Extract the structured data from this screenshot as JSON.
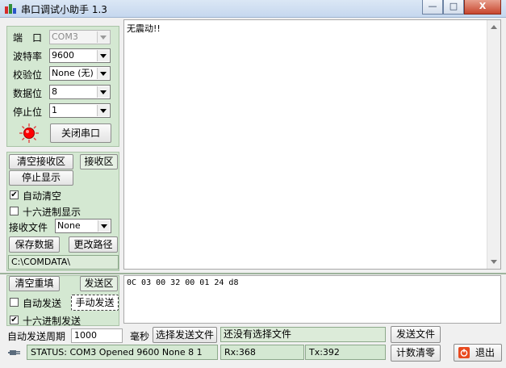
{
  "window": {
    "title": "串口调试小助手 1.3",
    "controls": {
      "min": "—",
      "max": "□",
      "close": "X"
    }
  },
  "settings": {
    "port_label": "端　口",
    "port_value": "COM3",
    "baud_label": "波特率",
    "baud_value": "9600",
    "parity_label": "校验位",
    "parity_value": "None (无)",
    "databits_label": "数据位",
    "databits_value": "8",
    "stopbits_label": "停止位",
    "stopbits_value": "1",
    "close_port_button": "关闭串口",
    "led_color": "#ff0000"
  },
  "receive": {
    "clear_button": "清空接收区",
    "area_label": "接收区",
    "stop_display_button": "停止显示",
    "auto_clear_label": "自动清空",
    "auto_clear_checked": true,
    "hex_display_label": "十六进制显示",
    "hex_display_checked": false,
    "file_label": "接收文件",
    "file_value": "None",
    "save_data_button": "保存数据",
    "change_path_button": "更改路径",
    "path_value": "C:\\COMDATA\\",
    "content": "无震动!!"
  },
  "send": {
    "clear_resend_button": "清空重填",
    "area_label": "发送区",
    "auto_send_label": "自动发送",
    "auto_send_checked": false,
    "manual_send_button": "手动发送",
    "hex_send_label": "十六进制发送",
    "hex_send_checked": true,
    "content": "0C 03 00 32 00 01 24 d8",
    "period_label": "自动发送周期",
    "period_value": "1000",
    "ms_label": "毫秒",
    "select_file_button": "选择发送文件",
    "file_status": "还没有选择文件",
    "send_file_button": "发送文件"
  },
  "status_bar": {
    "status": "STATUS: COM3 Opened 9600 None  8 1",
    "rx": "Rx:368",
    "tx": "Tx:392",
    "reset_count_button": "计数清零",
    "exit_button": "退出"
  },
  "colors": {
    "panel": "#d4e8d2",
    "exit_icon": "#e84a1f"
  }
}
